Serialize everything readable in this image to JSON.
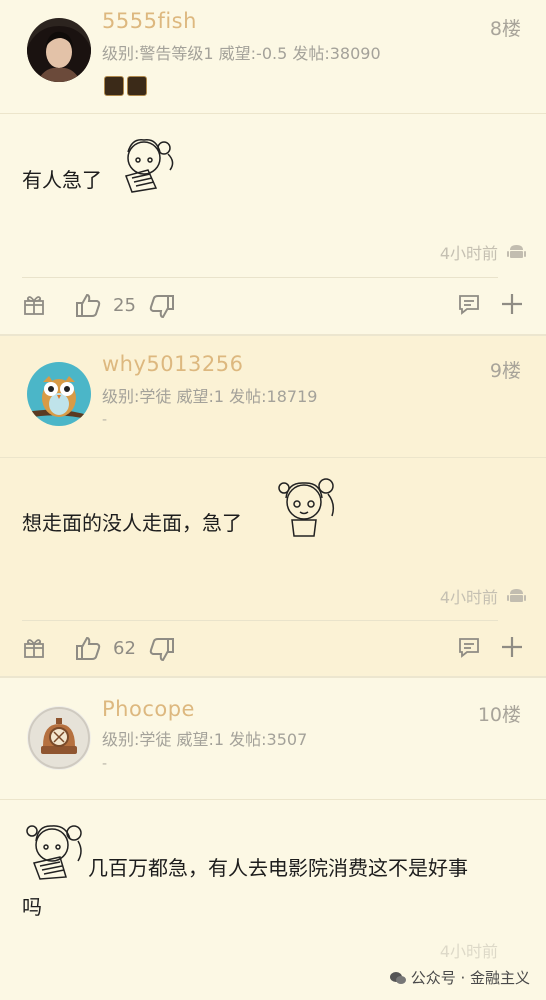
{
  "posts": [
    {
      "username": "5555fish",
      "meta": "级别:警告等级1 威望:-0.5 发帖:38090",
      "floor": "8楼",
      "content": "有人急了",
      "time": "4小时前",
      "likes": "25"
    },
    {
      "username": "why5013256",
      "meta": "级别:学徒 威望:1 发帖:18719",
      "dash": "-",
      "floor": "9楼",
      "content": "想走面的没人走面，急了",
      "time": "4小时前",
      "likes": "62"
    },
    {
      "username": "Phocope",
      "meta": "级别:学徒 威望:1 发帖:3507",
      "dash": "-",
      "floor": "10楼",
      "content_line1": "几百万都急，有人去电影院消费这不是好事",
      "content_line2": "吗",
      "time": "4小时前"
    }
  ],
  "watermark": "公众号 · 金融主义",
  "colors": {
    "username": "#ddb87f",
    "background": "#fdf9e6",
    "highlight_bg": "#fbf2d5"
  },
  "icons": [
    "gift-icon",
    "thumbs-up-icon",
    "thumbs-down-icon",
    "comment-icon",
    "plus-icon",
    "android-icon",
    "wechat-icon"
  ]
}
